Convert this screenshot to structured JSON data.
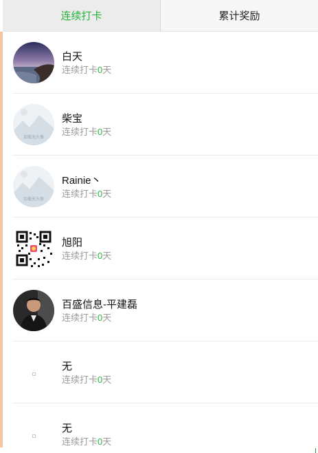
{
  "tabs": [
    {
      "label": "连续打卡",
      "active": true
    },
    {
      "label": "累计奖励",
      "active": false
    }
  ],
  "colors": {
    "accent": "#26b43a",
    "subtext": "#9b9b9b"
  },
  "items": [
    {
      "name": "白天",
      "sub_prefix": "连续打卡",
      "count": "0",
      "sub_suffix": "天",
      "avatar": "landscape-photo"
    },
    {
      "name": "柴宝",
      "sub_prefix": "连续打卡",
      "count": "0",
      "sub_suffix": "天",
      "avatar": "placeholder-image",
      "avatar_caption": "加载无头像"
    },
    {
      "name": "Rainie丶",
      "sub_prefix": "连续打卡",
      "count": "0",
      "sub_suffix": "天",
      "avatar": "placeholder-image",
      "avatar_caption": "加载无头像"
    },
    {
      "name": "旭阳",
      "sub_prefix": "连续打卡",
      "count": "0",
      "sub_suffix": "天",
      "avatar": "qr-code"
    },
    {
      "name": "百盛信息-平建磊",
      "sub_prefix": "连续打卡",
      "count": "0",
      "sub_suffix": "天",
      "avatar": "person-photo"
    },
    {
      "name": "无",
      "sub_prefix": "连续打卡",
      "count": "0",
      "sub_suffix": "天",
      "avatar": "broken-image"
    },
    {
      "name": "无",
      "sub_prefix": "连续打卡",
      "count": "0",
      "sub_suffix": "天",
      "avatar": "broken-image"
    }
  ]
}
